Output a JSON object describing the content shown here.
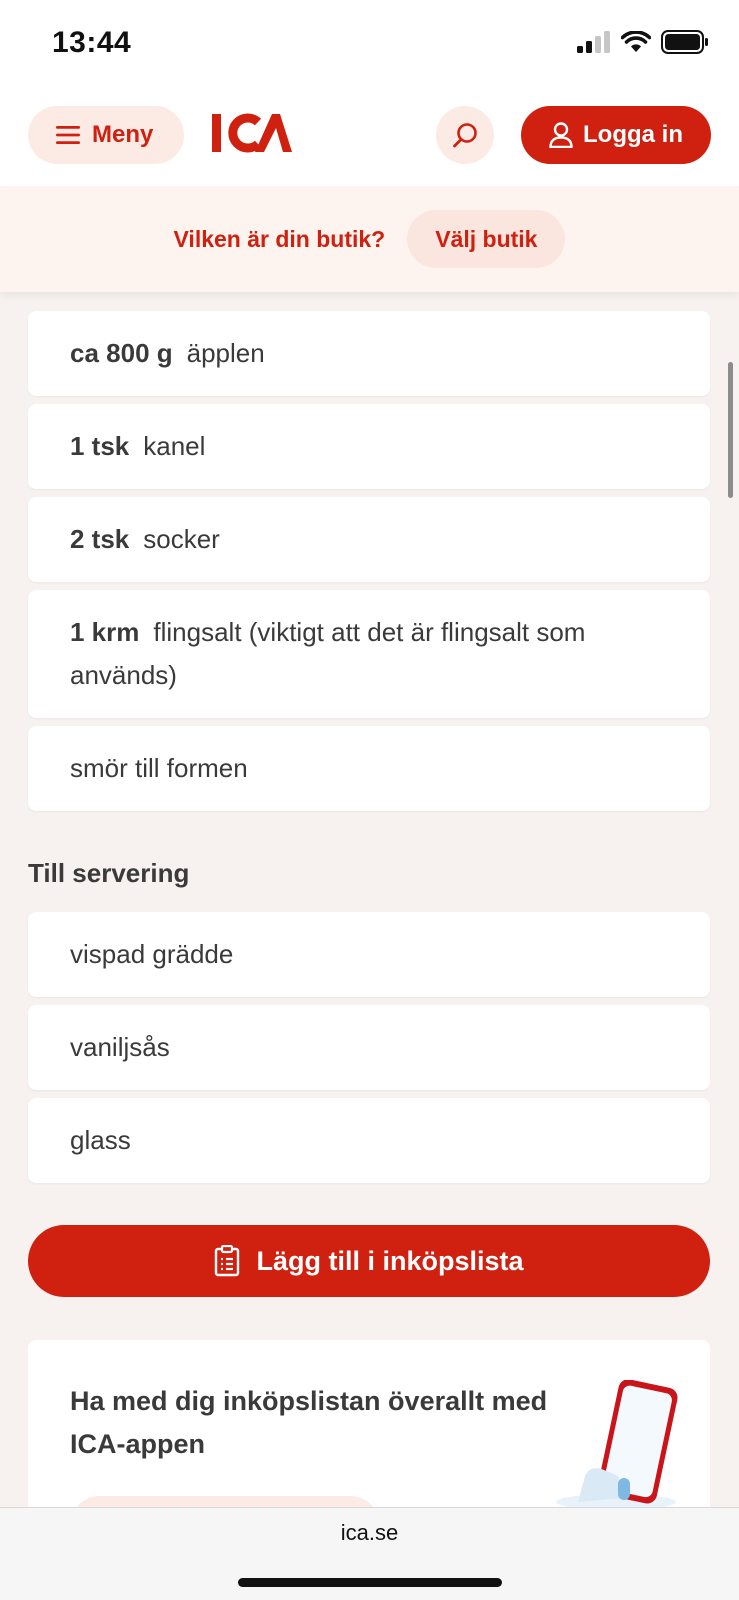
{
  "status_bar": {
    "time": "13:44"
  },
  "header": {
    "menu_label": "Meny",
    "logo_text": "ICA",
    "login_label": "Logga in"
  },
  "store_banner": {
    "question": "Vilken är din butik?",
    "button_label": "Välj butik"
  },
  "ingredients": [
    {
      "qty": "ca 800 g",
      "name": "äpplen"
    },
    {
      "qty": "1 tsk",
      "name": "kanel"
    },
    {
      "qty": "2 tsk",
      "name": "socker"
    },
    {
      "qty": "1 krm",
      "name": "flingsalt (viktigt att det är flingsalt som används)"
    },
    {
      "qty": "",
      "name": "smör till formen"
    }
  ],
  "serving": {
    "title": "Till servering",
    "items": [
      {
        "name": "vispad grädde"
      },
      {
        "name": "vaniljsås"
      },
      {
        "name": "glass"
      }
    ]
  },
  "add_to_list_label": "Lägg till i inköpslista",
  "app_promo": {
    "text": "Ha med dig inköpslistan överallt med ICA-appen"
  },
  "browser": {
    "url": "ica.se"
  },
  "colors": {
    "brand_red": "#cf2010",
    "light_pink": "#fcebe5",
    "page_bg": "#f7f2f0"
  }
}
